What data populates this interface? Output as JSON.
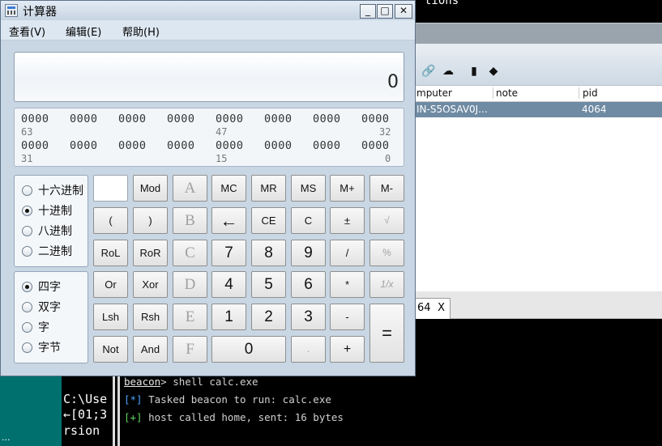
{
  "background": {
    "topline_text": "tions",
    "table": {
      "headers": [
        "mputer",
        "note",
        "pid"
      ],
      "row": {
        "computer": "IN-S5OSAV0J...",
        "note": "",
        "pid": "4064"
      }
    },
    "console_tab": {
      "label": "64",
      "close": "X"
    },
    "console": {
      "prompt": "beacon",
      "command": "> shell calc.exe",
      "line1_tag": "[*]",
      "line1": " Tasked beacon to run: calc.exe",
      "line2_tag": "[+]",
      "line2": " host called home, sent: 16 bytes"
    },
    "left_terminal": [
      "C:\\Use",
      "←[01;3",
      "rsion"
    ],
    "left_teal_text": "..."
  },
  "window": {
    "title": "计算器",
    "controls": {
      "minimize": "_",
      "maximize": "□",
      "close": "✕"
    }
  },
  "menu": {
    "view": "查看(V)",
    "edit": "编辑(E)",
    "help": "帮助(H)"
  },
  "display": {
    "value": "0"
  },
  "bits": {
    "row1": [
      "0000",
      "0000",
      "0000",
      "0000",
      "0000",
      "0000",
      "0000",
      "0000"
    ],
    "row1_marks": [
      "63",
      "47",
      "32"
    ],
    "row2": [
      "0000",
      "0000",
      "0000",
      "0000",
      "0000",
      "0000",
      "0000",
      "0000"
    ],
    "row2_marks": [
      "31",
      "15",
      "0"
    ]
  },
  "base_options": {
    "hex": "十六进制",
    "dec": "十进制",
    "oct": "八进制",
    "bin": "二进制",
    "selected": "十进制"
  },
  "word_options": {
    "qword": "四字",
    "dword": "双字",
    "word": "字",
    "byte": "字节",
    "selected": "四字"
  },
  "keys": {
    "mod": "Mod",
    "a": "A",
    "mc": "MC",
    "mr": "MR",
    "ms": "MS",
    "mplus": "M+",
    "mminus": "M-",
    "lparen": "(",
    "rparen": ")",
    "b": "B",
    "back": "←",
    "ce": "CE",
    "c": "C",
    "plusminus": "±",
    "sqrt": "√",
    "rol": "RoL",
    "ror": "RoR",
    "chex": "C",
    "seven": "7",
    "eight": "8",
    "nine": "9",
    "div": "/",
    "pct": "%",
    "or": "Or",
    "xor": "Xor",
    "d": "D",
    "four": "4",
    "five": "5",
    "six": "6",
    "mul": "*",
    "recip": "1/x",
    "lsh": "Lsh",
    "rsh": "Rsh",
    "e": "E",
    "one": "1",
    "two": "2",
    "three": "3",
    "minus": "-",
    "eq": "=",
    "not": "Not",
    "and": "And",
    "f": "F",
    "zero": "0",
    "dot": ".",
    "plus": "+"
  }
}
